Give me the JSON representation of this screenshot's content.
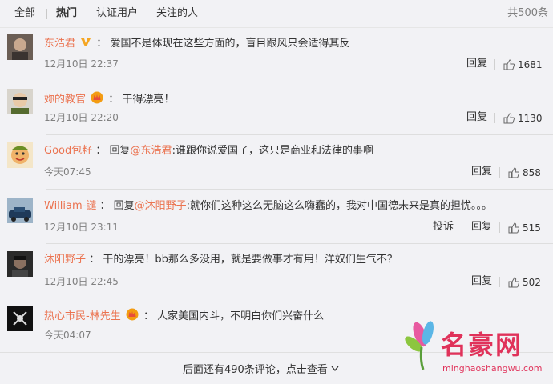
{
  "tabs": {
    "all": "全部",
    "hot": "热门",
    "verified": "认证用户",
    "following": "关注的人",
    "total": "共500条"
  },
  "comments": [
    {
      "user": "东浩君",
      "colon": "：",
      "text": "爱国不是体现在这些方面的，盲目跟风只会适得其反",
      "time": "12月10日 22:37",
      "reply": "回复",
      "likes": "1681",
      "badge": "v-icon"
    },
    {
      "user": "妳的教官",
      "colon": "：",
      "text": "干得漂亮！",
      "time": "12月10日 22:20",
      "reply": "回复",
      "likes": "1130",
      "badge": "crown-icon"
    },
    {
      "user": "Good包籽",
      "colon": "：",
      "reply_prefix": "回复",
      "mention": "@东浩君",
      "text": ":谁跟你说爱国了，这只是商业和法律的事啊",
      "time": "今天07:45",
      "reply": "回复",
      "likes": "858"
    },
    {
      "user": "William-譴",
      "colon": "：",
      "reply_prefix": "回复",
      "mention": "@沐阳野子",
      "text": ":就你们这种这么无脑这么嗨蠢的，我对中国德未来是真的担忧。。。",
      "time": "12月10日 23:11",
      "report": "投诉",
      "reply": "回复",
      "likes": "515"
    },
    {
      "user": "沐阳野子",
      "colon": "：",
      "text": "干的漂亮！bb那么多没用，就是要做事才有用！洋奴们生气不？",
      "time": "12月10日 22:45",
      "reply": "回复",
      "likes": "502"
    },
    {
      "user": "热心市民-林先生",
      "colon": "：",
      "text": "人家美国内斗，不明白你们兴奋什么",
      "time": "今天04:07",
      "badge": "crown-icon"
    }
  ],
  "more": "后面还有490条评论，点击查看",
  "watermark": {
    "cn": "名豪网",
    "url": "minghaoshangwu.com"
  },
  "colors": {
    "username": "#eb7350",
    "background": "#f2f2f5",
    "text": "#333333",
    "muted": "#808080"
  }
}
